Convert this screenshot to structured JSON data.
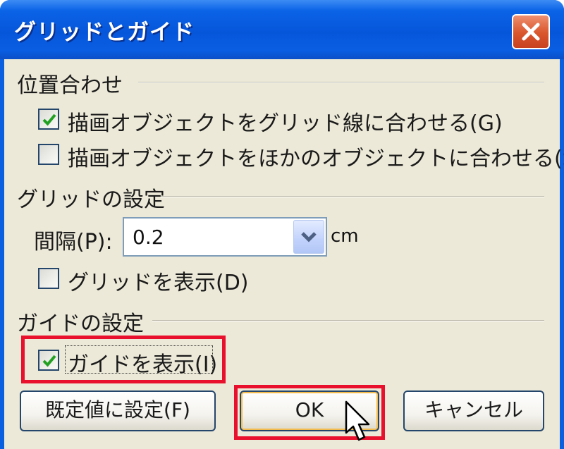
{
  "window": {
    "title": "グリッドとガイド"
  },
  "snap": {
    "title": "位置合わせ",
    "to_grid": {
      "label": "描画オブジェクトをグリッド線に合わせる(G)",
      "checked": true
    },
    "to_objects": {
      "label": "描画オブジェクトをほかのオブジェクトに合わせる(S)",
      "checked": false
    }
  },
  "grid": {
    "title": "グリッドの設定",
    "spacing_label": "間隔(P):",
    "spacing_value": "0.2",
    "spacing_unit": "cm",
    "show_grid": {
      "label": "グリッドを表示(D)",
      "checked": false
    }
  },
  "guide": {
    "title": "ガイドの設定",
    "show_guides": {
      "label": "ガイドを表示(I)",
      "checked": true
    }
  },
  "buttons": {
    "set_default": "既定値に設定(F)",
    "ok": "OK",
    "cancel": "キャンセル"
  },
  "colors": {
    "titlebar": "#0656da",
    "dialog_bg": "#ece9d8",
    "highlight": "#e8102d",
    "check_mark": "#21a121"
  },
  "icons": {
    "close": "close-icon",
    "dropdown": "chevron-down-icon",
    "cursor": "mouse-pointer-icon",
    "check": "check-icon"
  }
}
